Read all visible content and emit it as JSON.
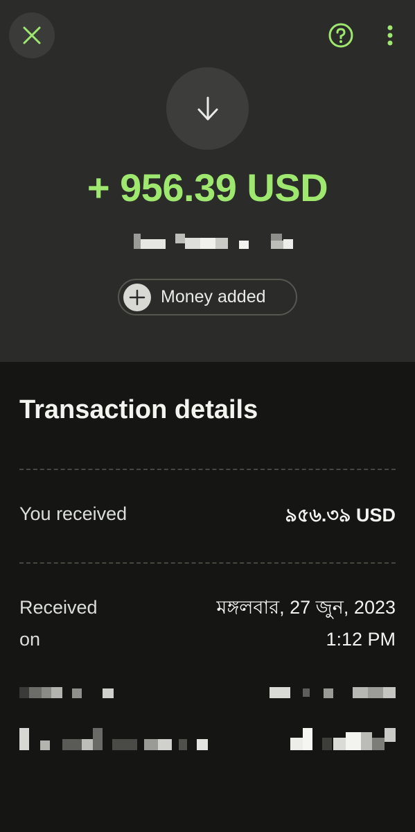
{
  "header": {
    "close_icon": "close-icon",
    "help_icon": "help-icon",
    "more_icon": "more-vertical-icon",
    "type_icon": "arrow-down-icon",
    "amount": "+ 956.39 USD",
    "category_chip": {
      "icon": "plus-icon",
      "label": "Money added"
    }
  },
  "details": {
    "title": "Transaction details",
    "rows": [
      {
        "label": "You received",
        "value": "৯৫৬.৩৯ USD"
      },
      {
        "label_line1": "Received",
        "label_line2": "on",
        "value_line1": "মঙ্গলবার, 27 জুন, 2023",
        "value_line2": "1:12 PM"
      }
    ]
  },
  "colors": {
    "accent": "#9fe870",
    "header_bg": "#2b2b2a",
    "body_bg": "#151614"
  }
}
